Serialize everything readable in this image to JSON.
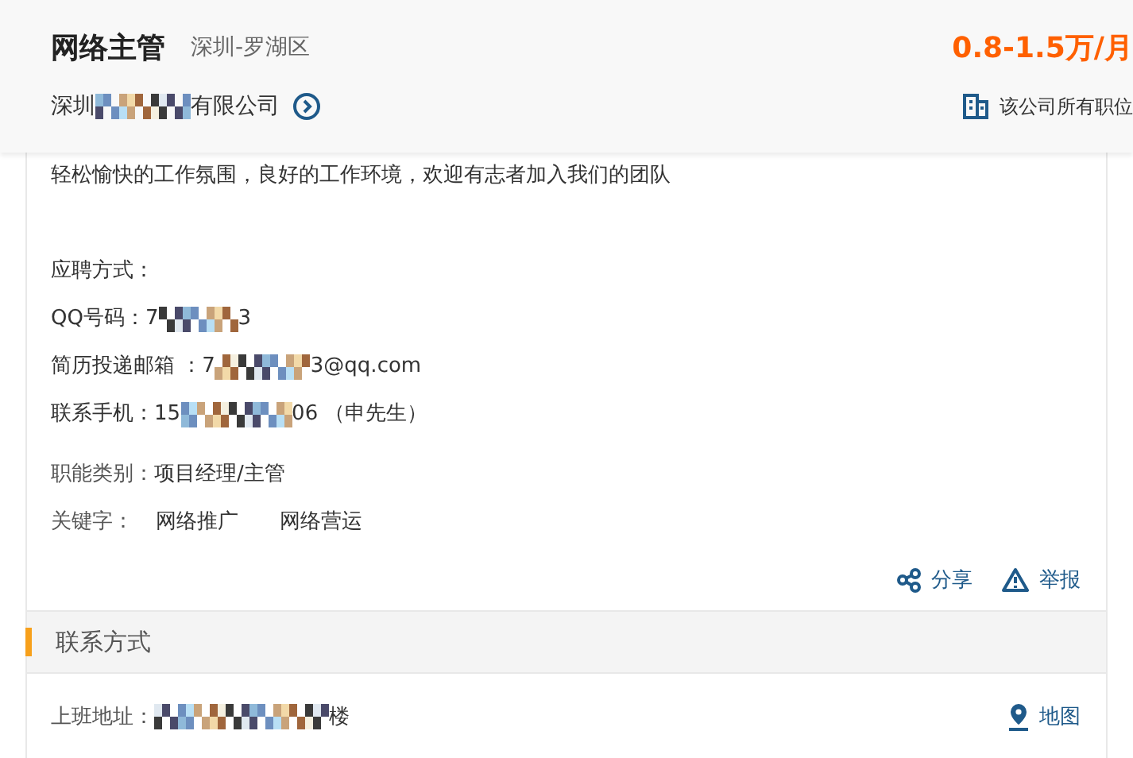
{
  "header": {
    "title": "网络主管",
    "location": "深圳-罗湖区",
    "salary": "0.8-1.5万/月",
    "company": {
      "prefix": "深圳",
      "suffix": "有限公司"
    },
    "all_jobs_link": "该公司所有职位"
  },
  "description": {
    "intro": "轻松愉快的工作氛围，良好的工作环境，欢迎有志者加入我们的团队",
    "apply_heading": "应聘方式：",
    "contacts": [
      {
        "label": "QQ号码：",
        "prefix": "7",
        "suffix": "3"
      },
      {
        "label": "简历投递邮箱 ：",
        "prefix": "7",
        "suffix": "3@qq.com"
      },
      {
        "label": "联系手机：",
        "prefix": "15",
        "suffix": "06 （申先生）"
      }
    ]
  },
  "category": {
    "label": "职能类别：",
    "value": "项目经理/主管"
  },
  "keywords": {
    "label": "关键字：",
    "items": [
      "网络推广",
      "网络营运"
    ]
  },
  "actions": [
    {
      "kind": "share",
      "label": "分享"
    },
    {
      "kind": "report",
      "label": "举报"
    }
  ],
  "contact_section": {
    "title": "联系方式",
    "address_label": "上班地址：",
    "address_suffix": "楼",
    "map_link": "地图"
  }
}
